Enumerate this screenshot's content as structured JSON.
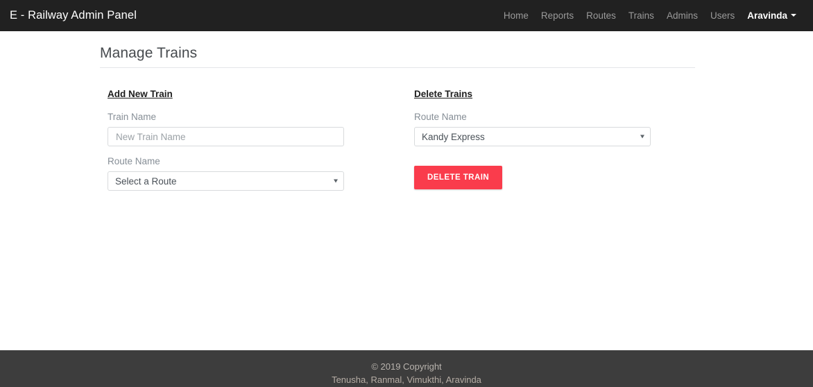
{
  "navbar": {
    "brand": "E - Railway Admin Panel",
    "links": [
      {
        "label": "Home",
        "name": "nav-link-home"
      },
      {
        "label": "Reports",
        "name": "nav-link-reports"
      },
      {
        "label": "Routes",
        "name": "nav-link-routes"
      },
      {
        "label": "Trains",
        "name": "nav-link-trains"
      },
      {
        "label": "Admins",
        "name": "nav-link-admins"
      },
      {
        "label": "Users",
        "name": "nav-link-users"
      }
    ],
    "user": "Aravinda",
    "user_caret_icon": "chevron-down-icon"
  },
  "page": {
    "title": "Manage Trains"
  },
  "add_train": {
    "heading": "Add New Train",
    "train_name_label": "Train Name",
    "train_name_placeholder": "New Train Name",
    "train_name_value": "",
    "route_name_label": "Route Name",
    "route_selected": "Select a Route",
    "route_options": [
      "Select a Route"
    ],
    "dropdown_icon": "caret-down-icon"
  },
  "delete_train": {
    "heading": "Delete Trains",
    "route_name_label": "Route Name",
    "route_selected": "Kandy Express",
    "route_options": [
      "Kandy Express"
    ],
    "dropdown_icon": "caret-down-icon",
    "button_label": "DELETE TRAIN",
    "button_color": "#fa3c4c"
  },
  "footer": {
    "copyright": "© 2019 Copyright",
    "authors": "Tenusha, Ranmal, Vimukthi, Aravinda"
  },
  "theme": {
    "navbar_bg": "#212121",
    "footer_bg": "#3d3d3d",
    "page_bg": "#ffffff",
    "accent_danger": "#fa3c4c",
    "label_color": "#868e96"
  }
}
